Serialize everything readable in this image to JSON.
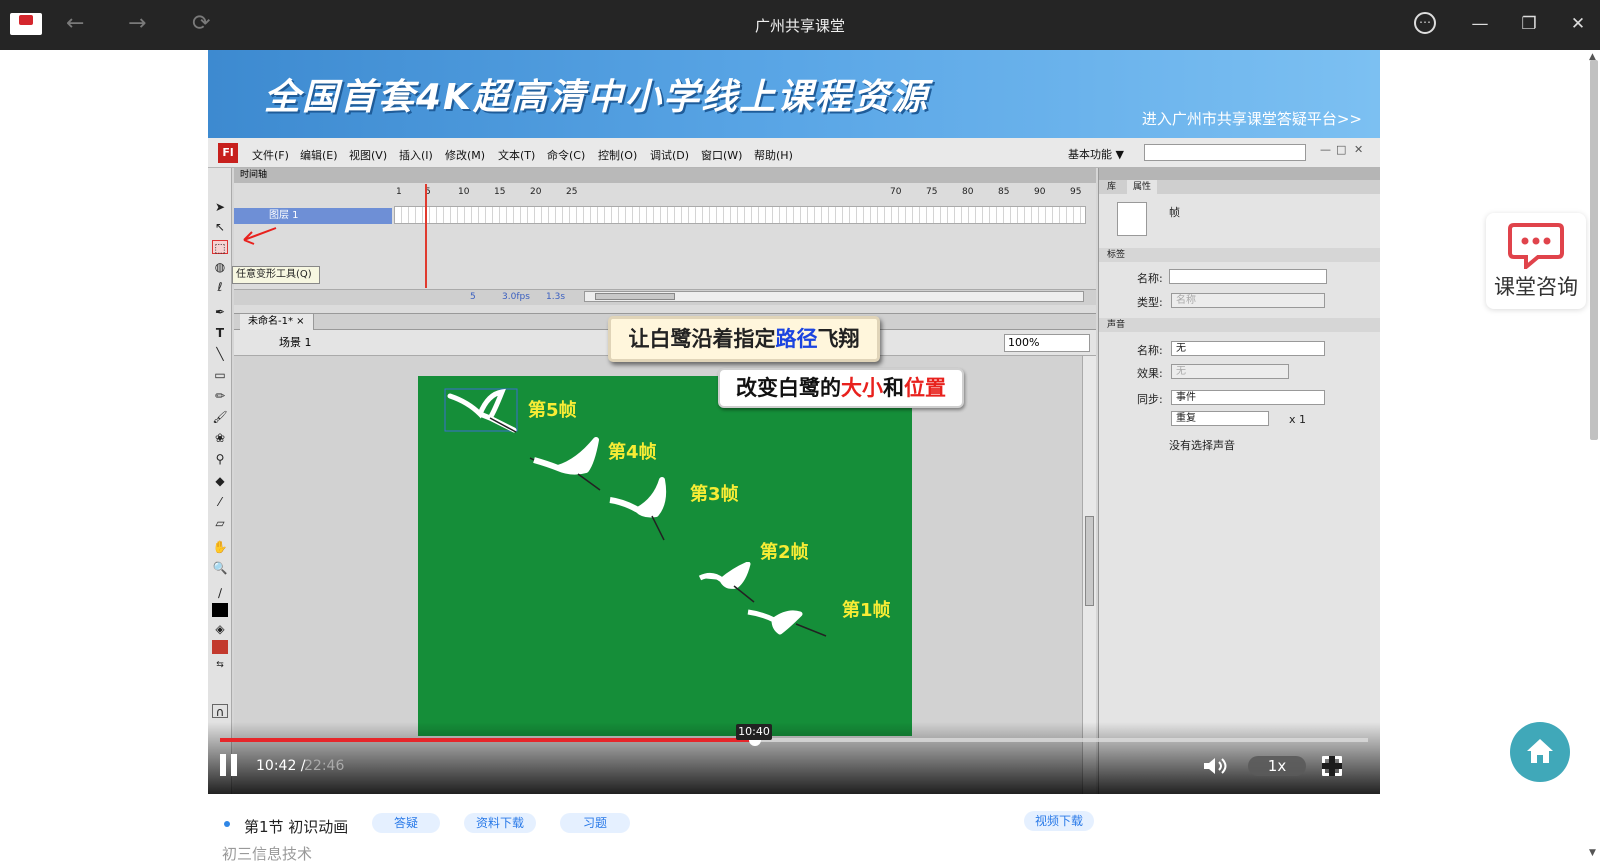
{
  "window": {
    "title": "广州共享课堂",
    "back_icon": "←",
    "forward_icon": "→",
    "reload_icon": "⟳",
    "more_icon": "⋯",
    "minimize_icon": "—",
    "restore_icon": "❐",
    "close_icon": "✕"
  },
  "banner": {
    "headline": "全国首套4K超高清中小学线上课程资源",
    "link": "进入广州市共享课堂答疑平台>>"
  },
  "flash": {
    "logo": "Fl",
    "menus": [
      "文件(F)",
      "编辑(E)",
      "视图(V)",
      "插入(I)",
      "修改(M)",
      "文本(T)",
      "命令(C)",
      "控制(O)",
      "调试(D)",
      "窗口(W)",
      "帮助(H)"
    ],
    "workspace": "基本功能 ▼",
    "timeline_tab": "时间轴",
    "layer_name": "图层 1",
    "ruler": [
      "1",
      "5",
      "10",
      "15",
      "20",
      "25",
      "70",
      "75",
      "80",
      "85",
      "90",
      "95"
    ],
    "timeline_footer": [
      "5",
      "3.0fps",
      "1.3s"
    ],
    "tooltip": "任意变形工具(Q)",
    "doc_tab": "未命名-1* ×",
    "scene": "场景 1",
    "zoom": "100%",
    "props_tabs": [
      "库",
      "属性"
    ],
    "props_type": "帧",
    "section_label": "标签",
    "section_sound": "声音",
    "name_label": "名称:",
    "type_label": "类型:",
    "type_value": "名称",
    "sound_name_value": "无",
    "effect_label": "效果:",
    "effect_value": "无",
    "sync_label": "同步:",
    "sync_value": "事件",
    "repeat_value": "重复",
    "repeat_times": "x 1",
    "no_sound": "没有选择声音"
  },
  "callouts": {
    "top_parts": [
      "让白鹭沿着指定",
      "路径",
      "飞翔"
    ],
    "stage_parts": [
      "改变白鹭的",
      "大小",
      "和",
      "位置"
    ]
  },
  "frames": [
    "第5帧",
    "第4帧",
    "第3帧",
    "第2帧",
    "第1帧"
  ],
  "player": {
    "current_time": "10:42",
    "separator": " /",
    "total_time": "22:46",
    "hover_time": "10:40",
    "progress": 0.466,
    "speed": "1x",
    "pause_icon": "pause",
    "volume_icon": "speaker",
    "fullscreen_icon": "expand"
  },
  "sidebar": {
    "consult_label": "课堂咨询",
    "home_icon": "home"
  },
  "lesson": {
    "title": "第1节 初识动画",
    "buttons": [
      "答疑",
      "资料下载",
      "习题"
    ],
    "video_download": "视频下载",
    "subject": "初三信息技术"
  },
  "colors": {
    "accent_red": "#e6262a",
    "stage_green": "#158e39",
    "frame_label_yellow": "#f7ec35",
    "home_teal": "#40a8b9",
    "pill_blue": "#2a7ae8"
  }
}
